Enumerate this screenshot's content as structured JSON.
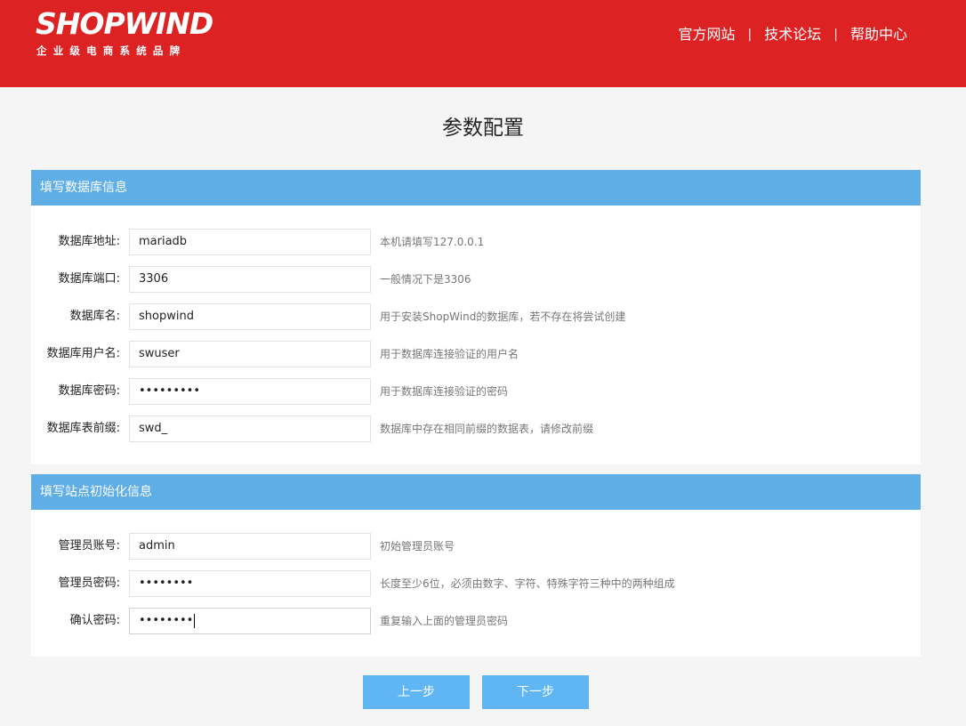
{
  "header": {
    "logo_text": "SHOPWIND",
    "slogan": "企业级电商系统品牌",
    "nav": [
      "官方网站",
      "技术论坛",
      "帮助中心"
    ],
    "separator": "|"
  },
  "page_title": "参数配置",
  "db_section": {
    "title": "填写数据库信息",
    "rows": [
      {
        "label": "数据库地址:",
        "value": "mariadb",
        "tip": "本机请填写127.0.0.1"
      },
      {
        "label": "数据库端口:",
        "value": "3306",
        "tip": "一般情况下是3306"
      },
      {
        "label": "数据库名:",
        "value": "shopwind",
        "tip": "用于安装ShopWind的数据库，若不存在将尝试创建"
      },
      {
        "label": "数据库用户名:",
        "value": "swuser",
        "tip": "用于数据库连接验证的用户名"
      },
      {
        "label": "数据库密码:",
        "value": "•••••••••",
        "tip": "用于数据库连接验证的密码"
      },
      {
        "label": "数据库表前缀:",
        "value": "swd_",
        "tip": "数据库中存在相同前缀的数据表，请修改前缀"
      }
    ]
  },
  "site_section": {
    "title": "填写站点初始化信息",
    "rows": [
      {
        "label": "管理员账号:",
        "value": "admin",
        "tip": "初始管理员账号"
      },
      {
        "label": "管理员密码:",
        "value": "••••••••",
        "tip": "长度至少6位，必须由数字、字符、特殊字符三种中的两种组成"
      },
      {
        "label": "确认密码:",
        "value": "••••••••",
        "tip": "重复输入上面的管理员密码"
      }
    ]
  },
  "buttons": {
    "prev": "上一步",
    "next": "下一步"
  },
  "colors": {
    "header": "#dd2224",
    "section_head": "#5faee6",
    "button": "#5fb6f2"
  }
}
